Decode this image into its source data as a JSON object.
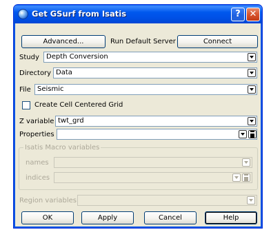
{
  "window": {
    "title": "Get GSurf from Isatis",
    "help_glyph": "?",
    "close_glyph": "✕"
  },
  "toolbar": {
    "advanced_label": "Advanced...",
    "server_text": "Run Default Server",
    "connect_label": "Connect"
  },
  "fields": {
    "study": {
      "label": "Study",
      "value": "Depth Conversion"
    },
    "directory": {
      "label": "Directory",
      "value": "Data"
    },
    "file": {
      "label": "File",
      "value": "Seismic"
    },
    "cell_centered": {
      "label": "Create Cell Centered Grid",
      "checked": false
    },
    "zvariable": {
      "label": "Z variable",
      "value": "twt_grd"
    },
    "properties": {
      "label": "Properties",
      "value": ""
    }
  },
  "macro_group": {
    "title": "Isatis Macro variables",
    "names_label": "names",
    "indices_label": "indices"
  },
  "region": {
    "label": "Region variables",
    "value": ""
  },
  "buttons": {
    "ok": "OK",
    "apply": "Apply",
    "cancel": "Cancel",
    "help": "Help"
  }
}
